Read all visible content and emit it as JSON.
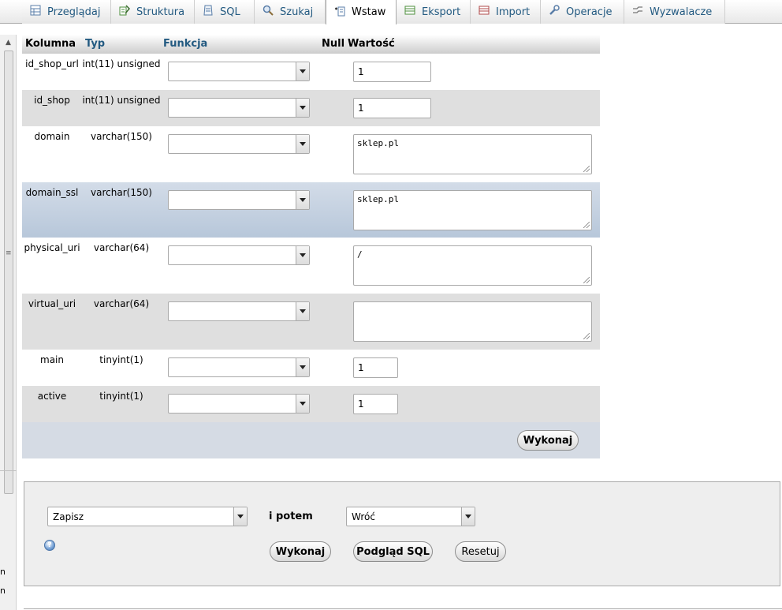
{
  "tabs": [
    {
      "label": "Przeglądaj",
      "icon": "browse-icon"
    },
    {
      "label": "Struktura",
      "icon": "structure-icon"
    },
    {
      "label": "SQL",
      "icon": "sql-icon"
    },
    {
      "label": "Szukaj",
      "icon": "search-icon"
    },
    {
      "label": "Wstaw",
      "icon": "insert-icon",
      "active": true
    },
    {
      "label": "Eksport",
      "icon": "export-icon"
    },
    {
      "label": "Import",
      "icon": "import-icon"
    },
    {
      "label": "Operacje",
      "icon": "wrench-icon"
    },
    {
      "label": "Wyzwalacze",
      "icon": "triggers-icon"
    }
  ],
  "table_header": {
    "column": "Kolumna",
    "type": "Typ",
    "function": "Funkcja",
    "null": "Null",
    "value": "Wartość"
  },
  "rows": [
    {
      "name": "id_shop_url",
      "type": "int(11) unsigned",
      "value": "1"
    },
    {
      "name": "id_shop",
      "type": "int(11) unsigned",
      "value": "1"
    },
    {
      "name": "domain",
      "type": "varchar(150)",
      "value": "sklep.pl"
    },
    {
      "name": "domain_ssl",
      "type": "varchar(150)",
      "value": "sklep.pl"
    },
    {
      "name": "physical_uri",
      "type": "varchar(64)",
      "value": "/"
    },
    {
      "name": "virtual_uri",
      "type": "varchar(64)",
      "value": ""
    },
    {
      "name": "main",
      "type": "tinyint(1)",
      "value": "1"
    },
    {
      "name": "active",
      "type": "tinyint(1)",
      "value": "1"
    }
  ],
  "execute_label": "Wykonaj",
  "actions": {
    "save_select": "Zapisz",
    "then_label": "i potem",
    "after_select": "Wróć",
    "execute_label": "Wykonaj",
    "preview_label": "Podgląd SQL",
    "reset_label": "Resetuj"
  },
  "left_fragments": [
    "n",
    "n"
  ],
  "colors": {
    "link": "#235a81",
    "row_even": "#dfdfdf",
    "row_highlight": "#b7c7da",
    "exec_bar": "#d5dbe4",
    "panel": "#eeeeee"
  }
}
